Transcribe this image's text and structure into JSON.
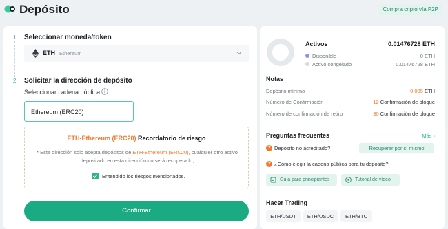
{
  "page": {
    "title": "Depósito",
    "p2p_button": "Compra cripto vía P2P"
  },
  "step1": {
    "number": "1",
    "title": "Seleccionar moneda/token",
    "selected_symbol": "ETH",
    "selected_name": "Ethereum"
  },
  "step2": {
    "number": "2",
    "title": "Solicitar la dirección de depósito",
    "chain_label": "Seleccionar cadena pública",
    "chain_value": "Ethereum (ERC20)"
  },
  "risk": {
    "title_highlight": "ETH-Ethereum (ERC20)",
    "title_rest": " Recordatorio de riesgo",
    "desc_prefix": "* Esta dirección solo acepta depósitos de ",
    "desc_highlight": "ETH-Ethereum (ERC20)",
    "desc_suffix": ", cualquier otro activo depositado en esta dirección no será recuperado;",
    "checkbox_label": "Entendido los riesgos mencionados.",
    "checked": true
  },
  "confirm_button": "Confirmar",
  "assets": {
    "title": "Activos",
    "total": "0.01476728 ETH",
    "available_label": "Disponible",
    "available_value": "0 ETH",
    "frozen_label": "Activo congelado",
    "frozen_value": "0.01476728 ETH"
  },
  "notes": {
    "title": "Notas",
    "min_label": "Depósito mínimo",
    "min_value": "0.005",
    "min_unit": "ETH",
    "confirm_label": "Número de Confirmación",
    "confirm_count": "12",
    "confirm_unit": "Confirmación de bloque",
    "withdraw_label": "Número de confirmación de retiro",
    "withdraw_count": "30",
    "withdraw_unit": "Confirmación de bloque"
  },
  "faq": {
    "title": "Preguntas frecuentes",
    "more": "Más",
    "q1": "Depósito no acreditado?",
    "q1_button": "Recuperar por sí mismo",
    "q2": "¿Cómo elegir la cadena pública para tu depósito?",
    "guide_button": "Guía para principiantes",
    "video_button": "Tutorial de vídeo"
  },
  "trading": {
    "title": "Hacer Trading",
    "pairs": [
      "ETH/USDT",
      "ETH/USDC",
      "ETH/BTC"
    ]
  },
  "colors": {
    "accent": "#1bab82",
    "warning": "#ee7a2f"
  }
}
